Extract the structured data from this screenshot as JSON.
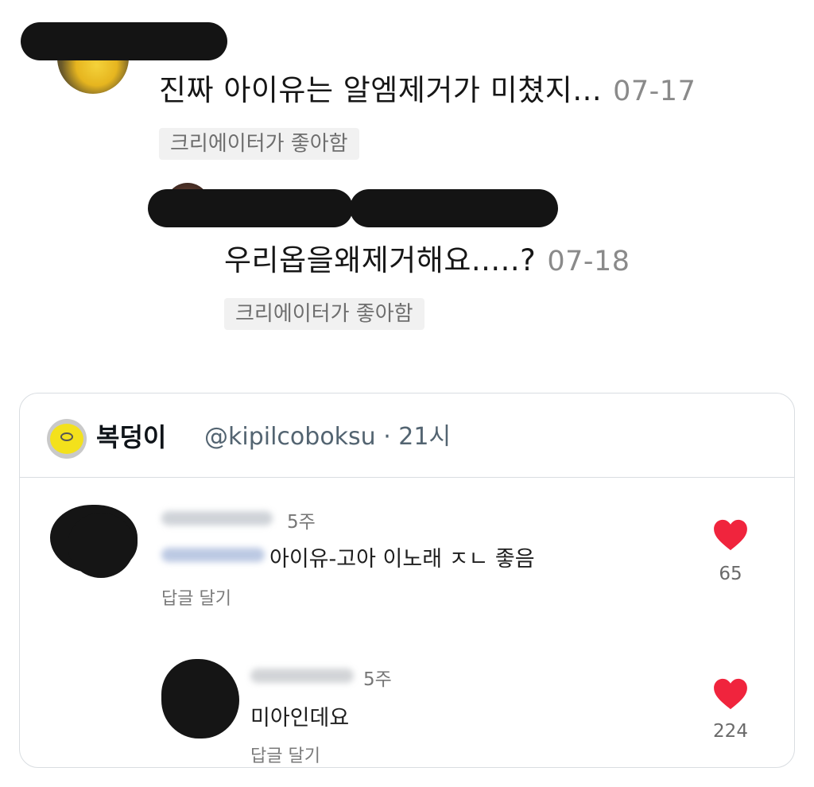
{
  "thread": {
    "comment1": {
      "text": "진짜 아이유는 알엠제거가 미쳤지...",
      "date": "07-17",
      "badge": "크리에이터가 좋아함"
    },
    "comment2": {
      "text": "우리옵을왜제거해요.....?",
      "date": "07-18",
      "badge": "크리에이터가 좋아함"
    }
  },
  "card": {
    "author_name": "복덩이",
    "author_handle": "@kipilcoboksu · 21시",
    "comments": [
      {
        "time": "5주",
        "text": "아이유-고아 이노래 ㅈㄴ 좋음",
        "reply_label": "답글 달기",
        "likes": "65",
        "heart_icon": "heart-icon"
      },
      {
        "time": "5주",
        "text": "미아인데요",
        "reply_label": "답글 달기",
        "likes": "224",
        "heart_icon": "heart-icon"
      }
    ]
  },
  "colors": {
    "heart": "#f0243d",
    "handle": "#536471",
    "badge_bg": "#f1f1f1",
    "date": "#8a8a8a"
  }
}
